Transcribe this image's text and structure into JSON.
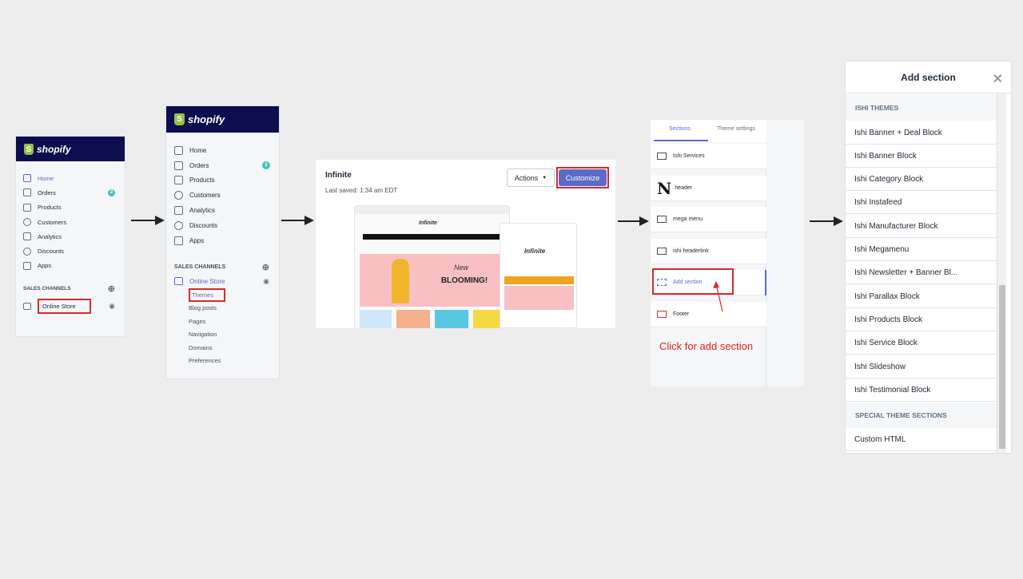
{
  "panel1": {
    "brand": "shopify",
    "nav": [
      {
        "label": "Home",
        "icon": "home-icon",
        "active": true
      },
      {
        "label": "Orders",
        "icon": "orders-icon",
        "badge": "2"
      },
      {
        "label": "Products",
        "icon": "tag-icon"
      },
      {
        "label": "Customers",
        "icon": "person-icon"
      },
      {
        "label": "Analytics",
        "icon": "bar-chart-icon"
      },
      {
        "label": "Discounts",
        "icon": "discount-icon"
      },
      {
        "label": "Apps",
        "icon": "apps-icon"
      }
    ],
    "sales_channels": "SALES CHANNELS",
    "online_store": "Online Store"
  },
  "panel2": {
    "brand": "shopify",
    "nav": [
      {
        "label": "Home",
        "icon": "home-icon"
      },
      {
        "label": "Orders",
        "icon": "orders-icon",
        "badge": "2"
      },
      {
        "label": "Products",
        "icon": "tag-icon"
      },
      {
        "label": "Customers",
        "icon": "person-icon"
      },
      {
        "label": "Analytics",
        "icon": "bar-chart-icon"
      },
      {
        "label": "Discounts",
        "icon": "discount-icon"
      },
      {
        "label": "Apps",
        "icon": "apps-icon"
      }
    ],
    "sales_channels": "SALES CHANNELS",
    "online_store": "Online Store",
    "sub": [
      "Themes",
      "Blog posts",
      "Pages",
      "Navigation",
      "Domains",
      "Preferences"
    ]
  },
  "theme": {
    "name": "Infinite",
    "saved": "Last saved: 1:34 am EDT",
    "actions": "Actions",
    "customize": "Customize",
    "preview_logo": "Infinite",
    "preview_new": "New",
    "preview_headline": "BLOOMING!"
  },
  "sections": {
    "tabs": [
      "Sections",
      "Theme settings"
    ],
    "rows": [
      "Ishi Services",
      "header",
      "mega menu",
      "ishi headerlink",
      "Add section",
      "Footer"
    ],
    "callout": "Click for add section"
  },
  "modal": {
    "title": "Add section",
    "group1": "ISHI THEMES",
    "items": [
      "Ishi Banner + Deal Block",
      "Ishi Banner Block",
      "Ishi Category Block",
      "Ishi Instafeed",
      "Ishi Manufacturer Block",
      "Ishi Megamenu",
      "Ishi Newsletter + Banner Bl...",
      "Ishi Parallax Block",
      "Ishi Products Block",
      "Ishi Service Block",
      "Ishi Slideshow",
      "Ishi Testimonial Block"
    ],
    "group2": "SPECIAL THEME SECTIONS",
    "items2": [
      "Custom HTML"
    ]
  },
  "colors": {
    "brand_bar": "#0d0e4e",
    "accent": "#5c6ac4",
    "highlight_box": "#d62b2b",
    "callout_text": "#e02020"
  }
}
